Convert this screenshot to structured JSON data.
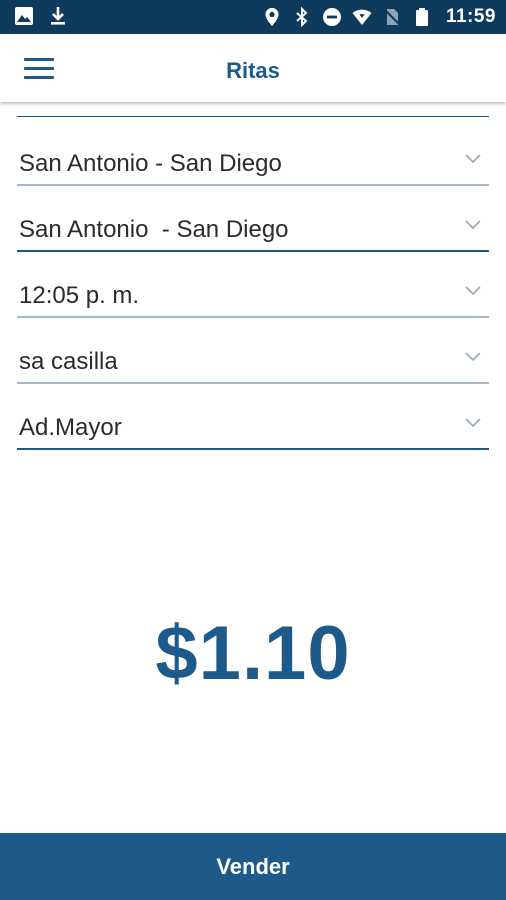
{
  "status_bar": {
    "time": "11:59",
    "left_icons": [
      "image-icon",
      "download-icon"
    ],
    "right_icons": [
      "location-icon",
      "bluetooth-icon",
      "do-not-disturb-icon",
      "wifi-icon",
      "no-sim-icon",
      "battery-icon"
    ]
  },
  "header": {
    "title": "Ritas",
    "menu_icon": "hamburger-menu-icon"
  },
  "form": {
    "fields": [
      {
        "value": "San Antonio - San Diego"
      },
      {
        "value": "San Antonio  - San Diego"
      },
      {
        "value": "12:05 p. m."
      },
      {
        "value": "sa casilla"
      },
      {
        "value": "Ad.Mayor"
      }
    ]
  },
  "price": "$1.10",
  "actions": {
    "sell_label": "Vender"
  },
  "colors": {
    "primary": "#1d5a8a",
    "status_bar": "#0e3a5c",
    "underline_gray": "#a9b8c6"
  }
}
